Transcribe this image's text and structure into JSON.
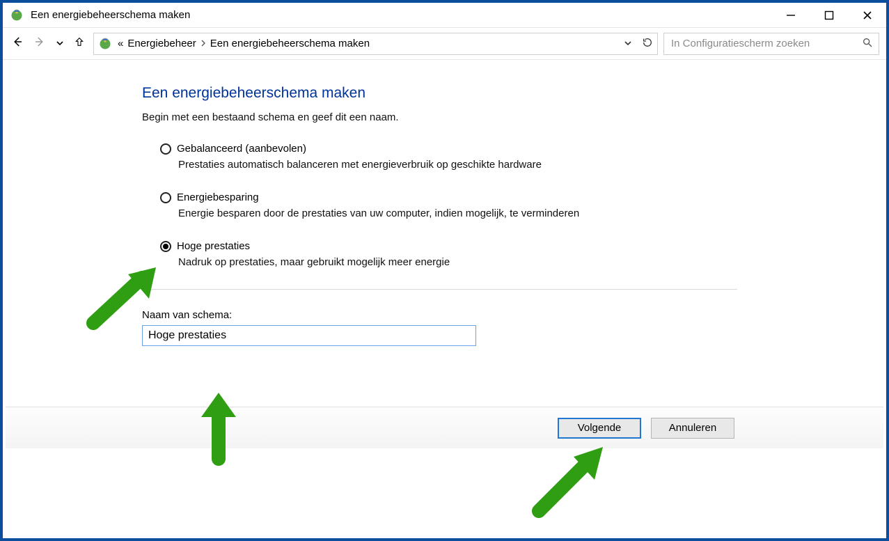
{
  "titlebar": {
    "title": "Een energiebeheerschema maken"
  },
  "breadcrumb": {
    "prefix": "«",
    "items": [
      "Energiebeheer",
      "Een energiebeheerschema maken"
    ]
  },
  "search": {
    "placeholder": "In Configuratiescherm zoeken"
  },
  "page": {
    "heading": "Een energiebeheerschema maken",
    "intro": "Begin met een bestaand schema en geef dit een naam."
  },
  "plans": [
    {
      "id": "balanced",
      "label": "Gebalanceerd (aanbevolen)",
      "desc": "Prestaties automatisch balanceren met energieverbruik op geschikte hardware",
      "checked": false
    },
    {
      "id": "energysave",
      "label": "Energiebesparing",
      "desc": "Energie besparen door de prestaties van uw computer, indien mogelijk, te verminderen",
      "checked": false
    },
    {
      "id": "highperf",
      "label": "Hoge prestaties",
      "desc": "Nadruk op prestaties, maar gebruikt mogelijk meer energie",
      "checked": true
    }
  ],
  "schema_name": {
    "label": "Naam van schema:",
    "value": "Hoge prestaties"
  },
  "buttons": {
    "next": "Volgende",
    "cancel": "Annuleren"
  }
}
